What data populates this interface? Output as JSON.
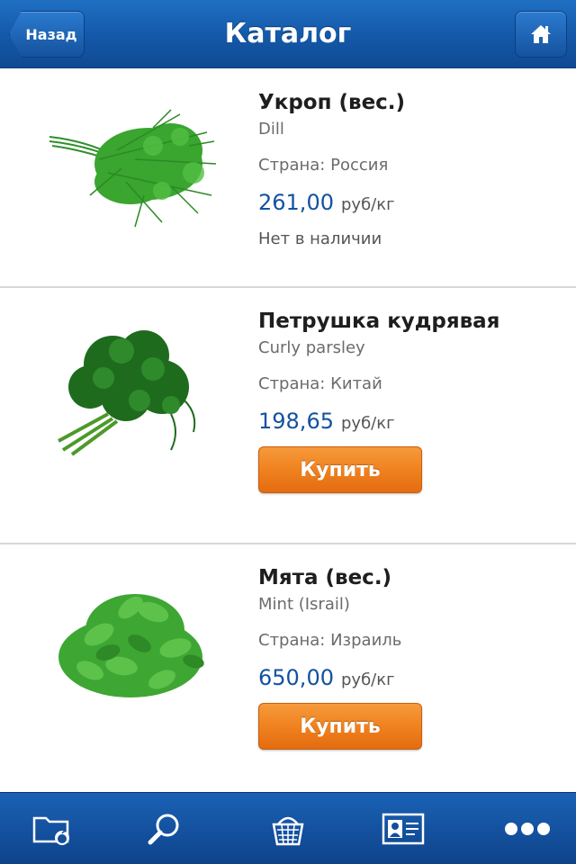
{
  "header": {
    "title": "Каталог",
    "back_label": "Назад",
    "home_icon": "home-icon"
  },
  "products": [
    {
      "name": "Укроп (вес.)",
      "latin": "Dill",
      "country": "Страна: Россия",
      "price": "261,00",
      "unit": "руб/кг",
      "status": "Нет в наличии",
      "image": "dill-image"
    },
    {
      "name": "Петрушка кудрявая",
      "latin": "Curly parsley",
      "country": "Страна: Китай",
      "price": "198,65",
      "unit": "руб/кг",
      "buy_label": "Купить",
      "image": "parsley-image"
    },
    {
      "name": "Мята (вес.)",
      "latin": "Mint (Israil)",
      "country": "Страна: Израиль",
      "price": "650,00",
      "unit": "руб/кг",
      "buy_label": "Купить",
      "image": "mint-image"
    }
  ],
  "tabbar": {
    "items": [
      "catalog-folder-icon",
      "search-icon",
      "basket-icon",
      "profile-card-icon",
      "more-icon"
    ]
  },
  "colors": {
    "header_blue": "#1458a8",
    "price_blue": "#1352a0",
    "buy_orange": "#ef7f1d"
  }
}
